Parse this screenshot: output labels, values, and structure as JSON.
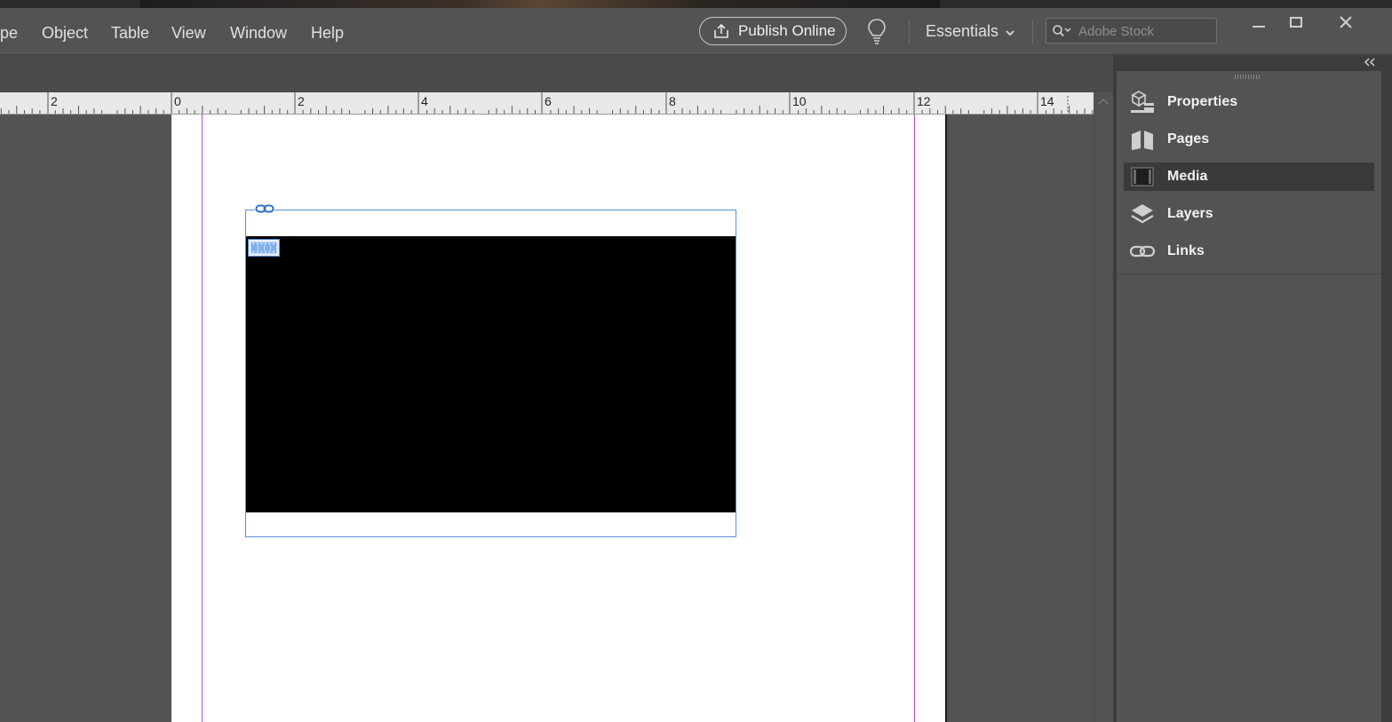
{
  "menu": {
    "items": [
      "pe",
      "Object",
      "Table",
      "View",
      "Window",
      "Help"
    ]
  },
  "toolbar": {
    "publish_label": "Publish Online",
    "workspace_label": "Essentials",
    "search_placeholder": "Adobe Stock"
  },
  "ruler": {
    "labels": [
      "2",
      "0",
      "2",
      "4",
      "6",
      "8",
      "10",
      "12",
      "14"
    ]
  },
  "panel": {
    "items": [
      {
        "label": "Properties",
        "icon": "properties-icon",
        "active": false
      },
      {
        "label": "Pages",
        "icon": "pages-icon",
        "active": false
      },
      {
        "label": "Media",
        "icon": "media-icon",
        "active": true
      },
      {
        "label": "Layers",
        "icon": "layers-icon",
        "active": false
      },
      {
        "label": "Links",
        "icon": "links-icon",
        "active": false
      }
    ]
  },
  "colors": {
    "ui_background": "#535353",
    "margin_guide": "#b04cc9",
    "frame_selection": "#5b8fd6"
  }
}
